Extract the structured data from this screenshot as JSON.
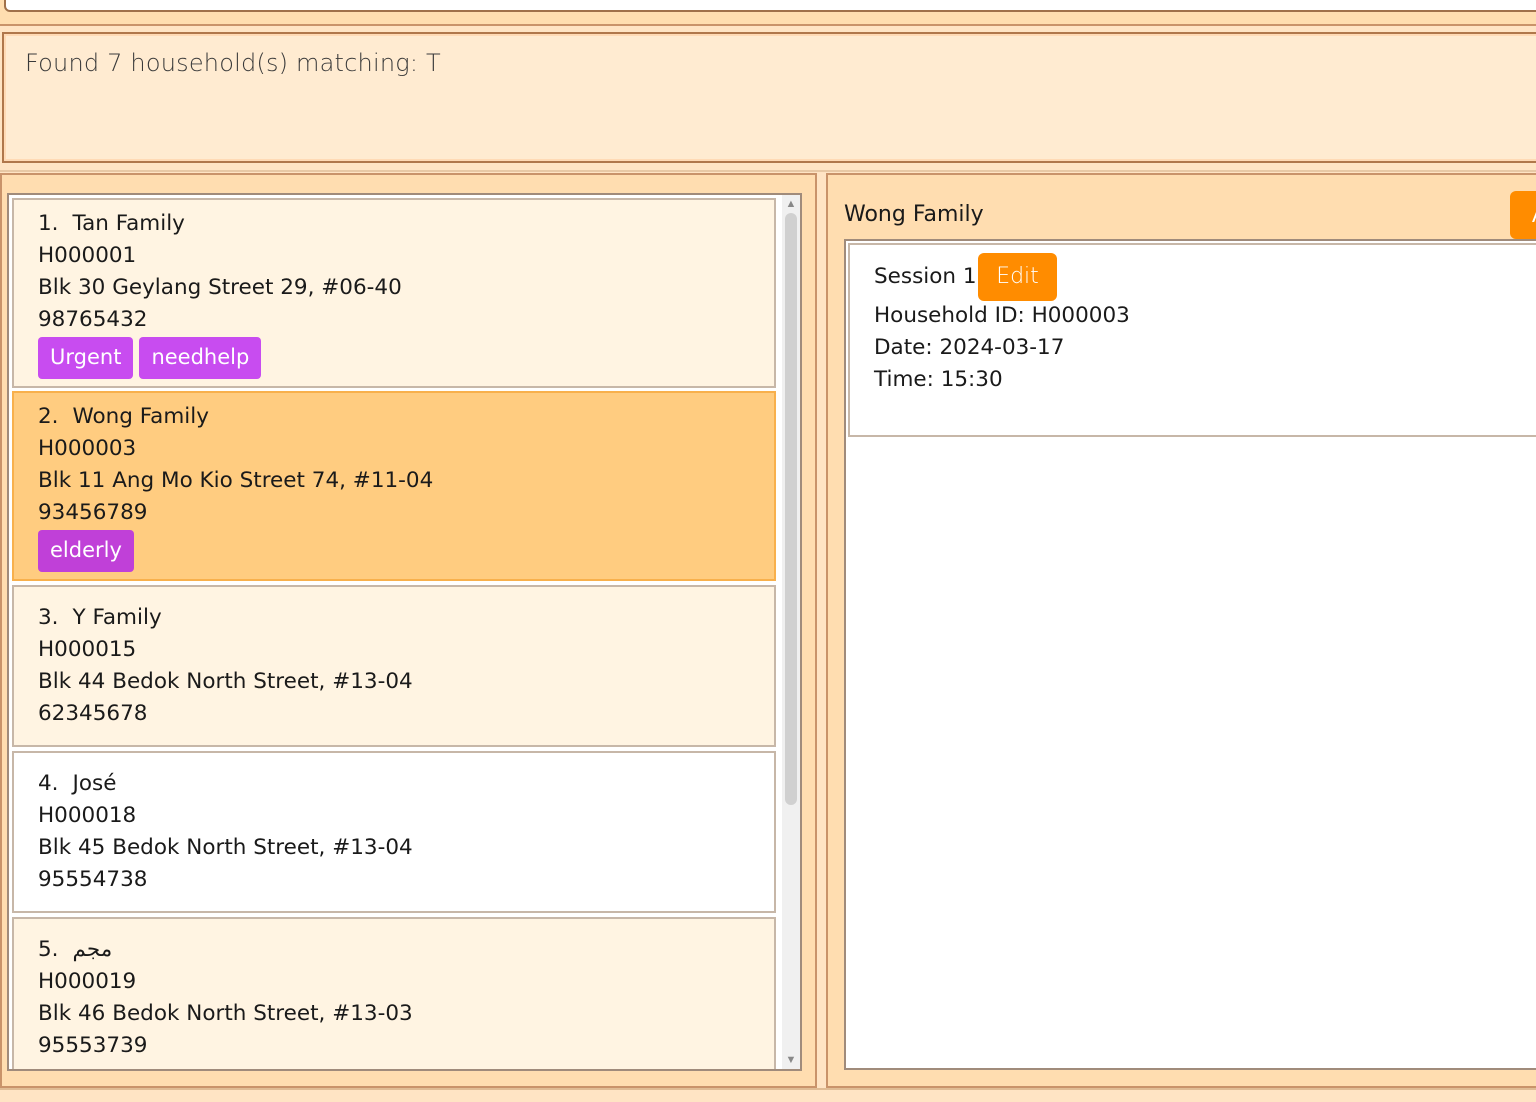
{
  "result": {
    "message": "Found 7 household(s) matching: T"
  },
  "households": [
    {
      "index": "1.",
      "name": "Tan Family",
      "id": "H000001",
      "address": "Blk 30 Geylang Street 29, #06-40",
      "phone": "98765432",
      "tags": [
        "Urgent",
        "needhelp"
      ]
    },
    {
      "index": "2.",
      "name": "Wong Family",
      "id": "H000003",
      "address": "Blk 11 Ang Mo Kio Street 74, #11-04",
      "phone": "93456789",
      "tags": [
        "elderly"
      ]
    },
    {
      "index": "3.",
      "name": "Y Family",
      "id": "H000015",
      "address": "Blk 44 Bedok North Street, #13-04",
      "phone": "62345678",
      "tags": []
    },
    {
      "index": "4.",
      "name": "José",
      "id": "H000018",
      "address": "Blk 45 Bedok North Street, #13-04",
      "phone": "95554738",
      "tags": []
    },
    {
      "index": "5.",
      "name": "مجم",
      "id": "H000019",
      "address": "Blk 46 Bedok North Street, #13-03",
      "phone": "95553739",
      "tags": []
    }
  ],
  "detail": {
    "title": "Wong Family",
    "add_label": "A",
    "session": {
      "label": "Session 1",
      "edit_label": "Edit",
      "household_id": "Household ID: H000003",
      "date": "Date: 2024-03-17",
      "time": "Time: 15:30"
    }
  },
  "colors": {
    "accent": "#FF8C00",
    "tag": "#C84CF0",
    "selected": "#FFCC80"
  }
}
